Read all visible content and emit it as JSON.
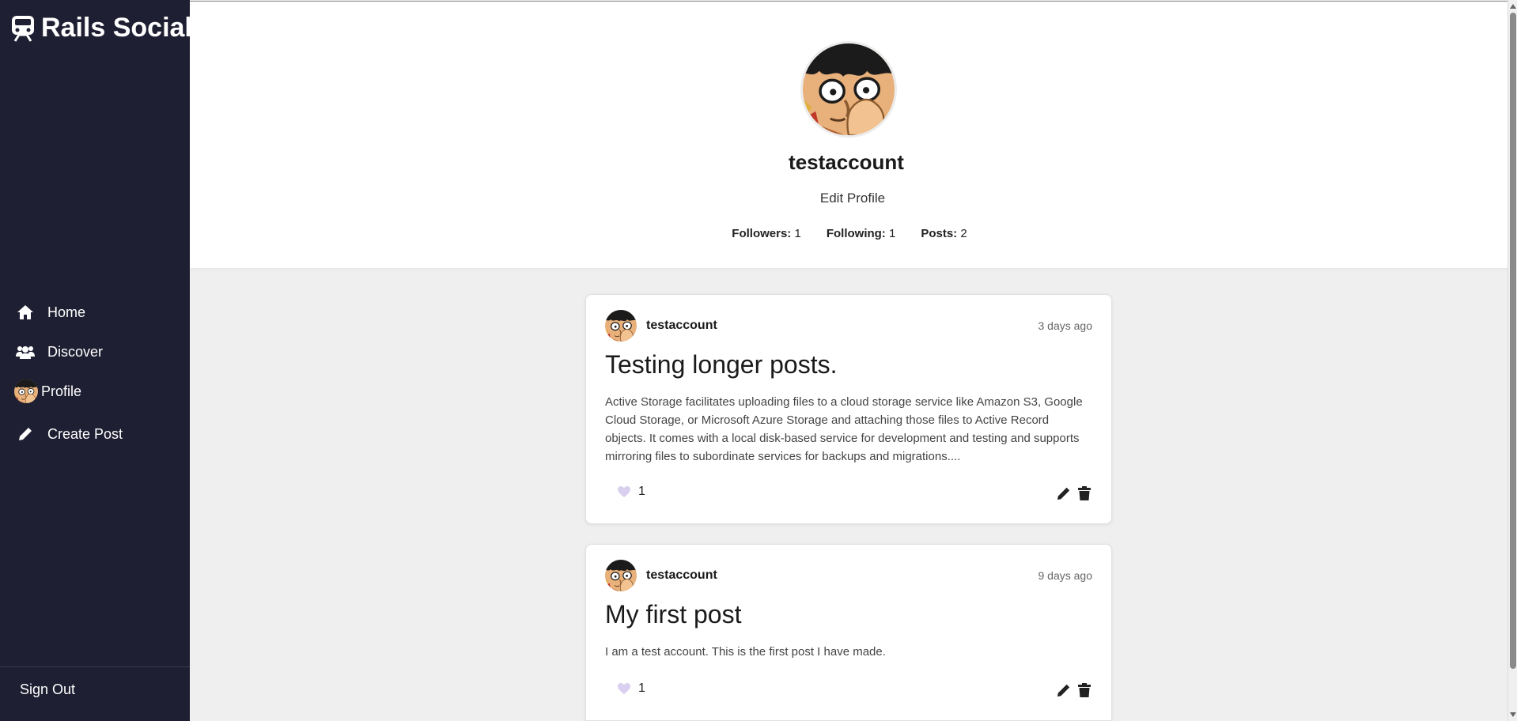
{
  "app": {
    "brand": "Rails Social"
  },
  "sidebar": {
    "items": [
      {
        "label": "Home",
        "icon": "home-icon"
      },
      {
        "label": "Discover",
        "icon": "users-icon"
      },
      {
        "label": "Profile",
        "icon": "avatar"
      },
      {
        "label": "Create Post",
        "icon": "pencil-icon"
      }
    ],
    "sign_out": "Sign Out"
  },
  "profile": {
    "username": "testaccount",
    "edit_label": "Edit Profile",
    "stats": {
      "followers_label": "Followers:",
      "followers": "1",
      "following_label": "Following:",
      "following": "1",
      "posts_label": "Posts:",
      "posts": "2"
    }
  },
  "posts": [
    {
      "author": "testaccount",
      "time": "3 days ago",
      "title": "Testing longer posts.",
      "body": "Active Storage facilitates uploading files to a cloud storage service like Amazon S3, Google Cloud Storage, or Microsoft Azure Storage and attaching those files to Active Record objects. It comes with a local disk-based service for development and testing and supports mirroring files to subordinate services for backups and migrations....",
      "likes": "1"
    },
    {
      "author": "testaccount",
      "time": "9 days ago",
      "title": "My first post",
      "body": "I am a test account. This is the first post I have made.",
      "likes": "1"
    }
  ],
  "colors": {
    "sidebar_bg": "#1f1f33",
    "main_bg": "#efefef",
    "card_bg": "#ffffff",
    "heart": "#d9cfee"
  }
}
